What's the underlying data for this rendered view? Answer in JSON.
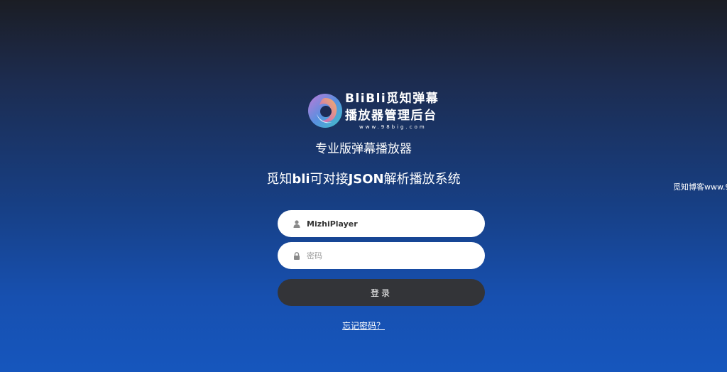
{
  "logo": {
    "line1": "BliBli觅知弹幕",
    "line2": "播放器管理后台",
    "url": "www.98big.com",
    "icon": "swirl-logo-icon"
  },
  "subtitle": "专业版弹幕播放器",
  "tagline": {
    "p1": "觅知",
    "b1": "bli",
    "p2": "可对接",
    "b2": "JSON",
    "p3": "解析播放系统"
  },
  "side_note": "觅知博客www.9",
  "login": {
    "username_value": "MizhiPlayer",
    "username_icon": "user-icon",
    "password_placeholder": "密码",
    "password_icon": "lock-icon",
    "button_label": "登录",
    "forgot_label": "忘记密码？"
  },
  "colors": {
    "button_bg": "#333438",
    "bg_top": "#1b1d24",
    "bg_bottom": "#1656bd"
  }
}
